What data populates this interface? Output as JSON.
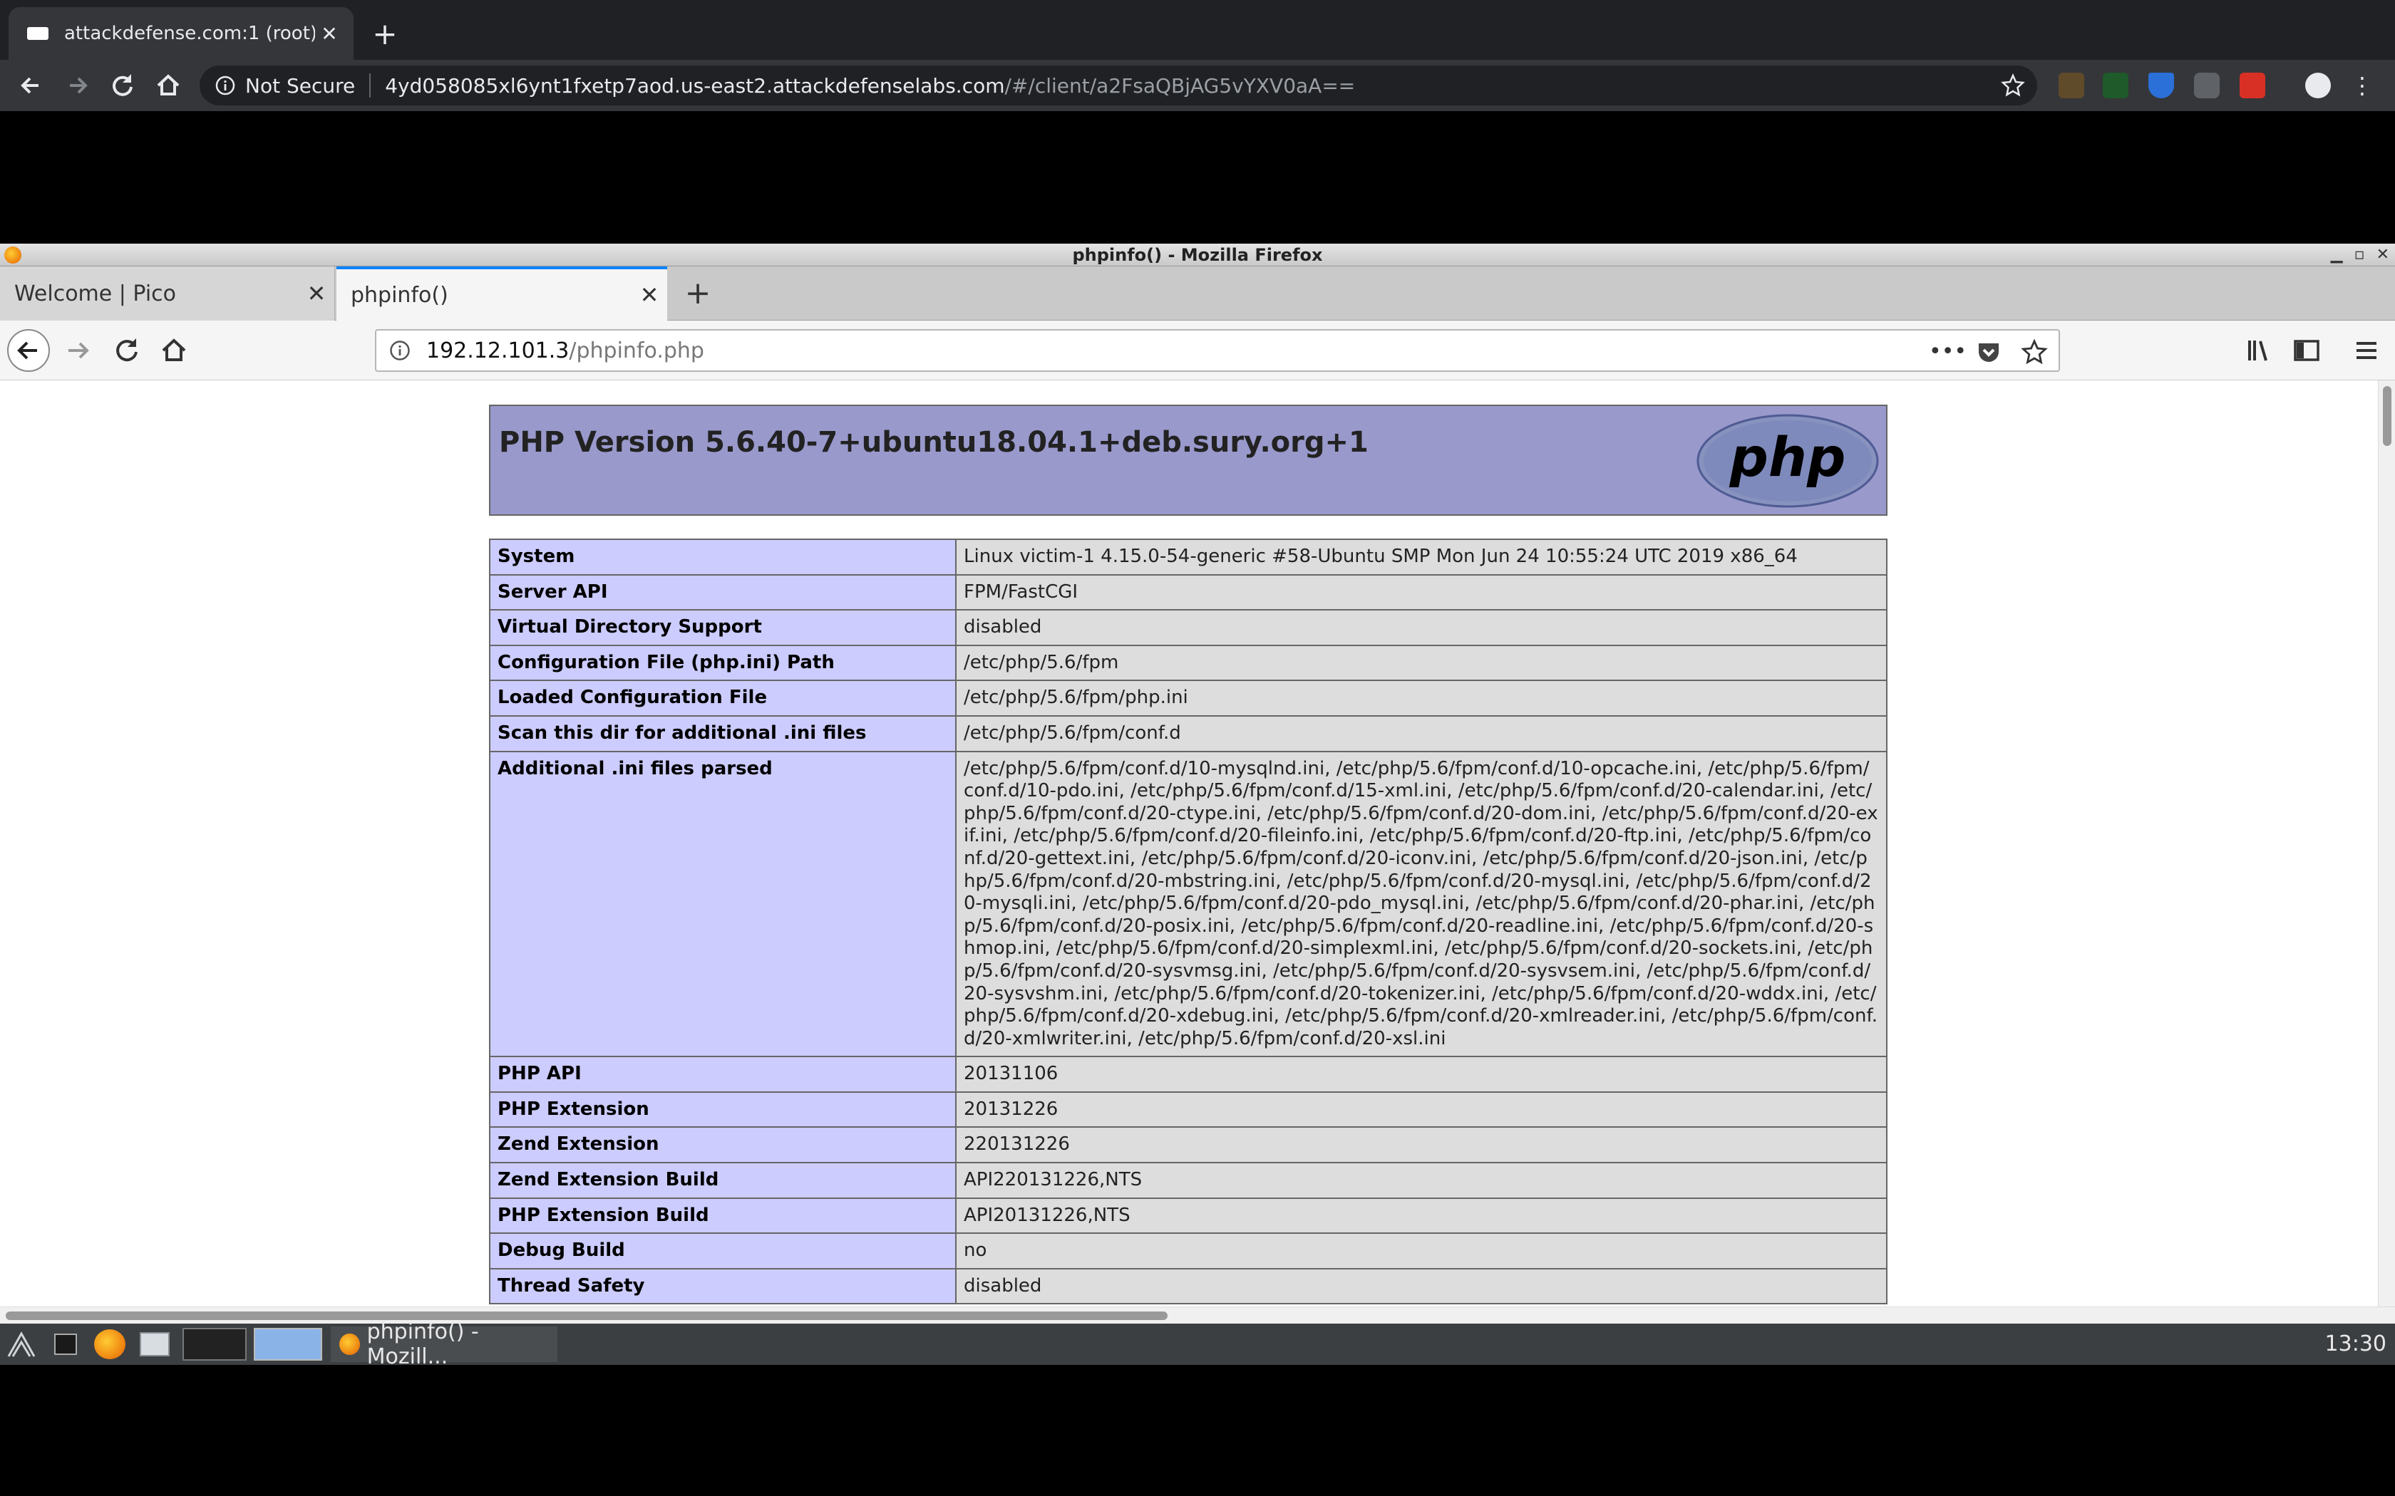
{
  "chrome": {
    "tab_title": "attackdefense.com:1 (root)",
    "new_tab": "+",
    "close": "✕",
    "security_label": "Not Secure",
    "url_host": "4yd058085xl6ynt1fxetp7aod.us-east2.attackdefenselabs.com",
    "url_path": "/#/client/a2FsaQBjAG5vYXV0aA=="
  },
  "firefox": {
    "window_title": "phpinfo() - Mozilla Firefox",
    "window_buttons": [
      "▁",
      "▫",
      "✕"
    ],
    "tabs": [
      {
        "label": "Welcome | Pico"
      },
      {
        "label": "phpinfo()"
      }
    ],
    "tab_close": "✕",
    "new_tab": "+",
    "url_host": "192.12.101.3",
    "url_path": "/phpinfo.php",
    "overflow_menu": "•••"
  },
  "page": {
    "php_version": "PHP Version 5.6.40-7+ubuntu18.04.1+deb.sury.org+1",
    "logo_text": "php",
    "rows": [
      {
        "key": "System",
        "value": "Linux victim-1 4.15.0-54-generic #58-Ubuntu SMP Mon Jun 24 10:55:24 UTC 2019 x86_64"
      },
      {
        "key": "Server API",
        "value": "FPM/FastCGI"
      },
      {
        "key": "Virtual Directory Support",
        "value": "disabled"
      },
      {
        "key": "Configuration File (php.ini) Path",
        "value": "/etc/php/5.6/fpm"
      },
      {
        "key": "Loaded Configuration File",
        "value": "/etc/php/5.6/fpm/php.ini"
      },
      {
        "key": "Scan this dir for additional .ini files",
        "value": "/etc/php/5.6/fpm/conf.d"
      },
      {
        "key": "Additional .ini files parsed",
        "value": "/etc/php/5.6/fpm/conf.d/10-mysqlnd.ini, /etc/php/5.6/fpm/conf.d/10-opcache.ini, /etc/php/5.6/fpm/conf.d/10-pdo.ini, /etc/php/5.6/fpm/conf.d/15-xml.ini, /etc/php/5.6/fpm/conf.d/20-calendar.ini, /etc/php/5.6/fpm/conf.d/20-ctype.ini, /etc/php/5.6/fpm/conf.d/20-dom.ini, /etc/php/5.6/fpm/conf.d/20-exif.ini, /etc/php/5.6/fpm/conf.d/20-fileinfo.ini, /etc/php/5.6/fpm/conf.d/20-ftp.ini, /etc/php/5.6/fpm/conf.d/20-gettext.ini, /etc/php/5.6/fpm/conf.d/20-iconv.ini, /etc/php/5.6/fpm/conf.d/20-json.ini, /etc/php/5.6/fpm/conf.d/20-mbstring.ini, /etc/php/5.6/fpm/conf.d/20-mysql.ini, /etc/php/5.6/fpm/conf.d/20-mysqli.ini, /etc/php/5.6/fpm/conf.d/20-pdo_mysql.ini, /etc/php/5.6/fpm/conf.d/20-phar.ini, /etc/php/5.6/fpm/conf.d/20-posix.ini, /etc/php/5.6/fpm/conf.d/20-readline.ini, /etc/php/5.6/fpm/conf.d/20-shmop.ini, /etc/php/5.6/fpm/conf.d/20-simplexml.ini, /etc/php/5.6/fpm/conf.d/20-sockets.ini, /etc/php/5.6/fpm/conf.d/20-sysvmsg.ini, /etc/php/5.6/fpm/conf.d/20-sysvsem.ini, /etc/php/5.6/fpm/conf.d/20-sysvshm.ini, /etc/php/5.6/fpm/conf.d/20-tokenizer.ini, /etc/php/5.6/fpm/conf.d/20-wddx.ini, /etc/php/5.6/fpm/conf.d/20-xdebug.ini, /etc/php/5.6/fpm/conf.d/20-xmlreader.ini, /etc/php/5.6/fpm/conf.d/20-xmlwriter.ini, /etc/php/5.6/fpm/conf.d/20-xsl.ini"
      },
      {
        "key": "PHP API",
        "value": "20131106"
      },
      {
        "key": "PHP Extension",
        "value": "20131226"
      },
      {
        "key": "Zend Extension",
        "value": "220131226"
      },
      {
        "key": "Zend Extension Build",
        "value": "API220131226,NTS"
      },
      {
        "key": "PHP Extension Build",
        "value": "API20131226,NTS"
      },
      {
        "key": "Debug Build",
        "value": "no"
      },
      {
        "key": "Thread Safety",
        "value": "disabled"
      }
    ]
  },
  "taskbar": {
    "task_label": "phpinfo() - Mozill...",
    "clock": "13:30"
  },
  "colors": {
    "php_header": "#9999cc",
    "key_cell": "#ccccff",
    "value_cell": "#dddddd",
    "firefox_accent": "#0a84ff"
  }
}
